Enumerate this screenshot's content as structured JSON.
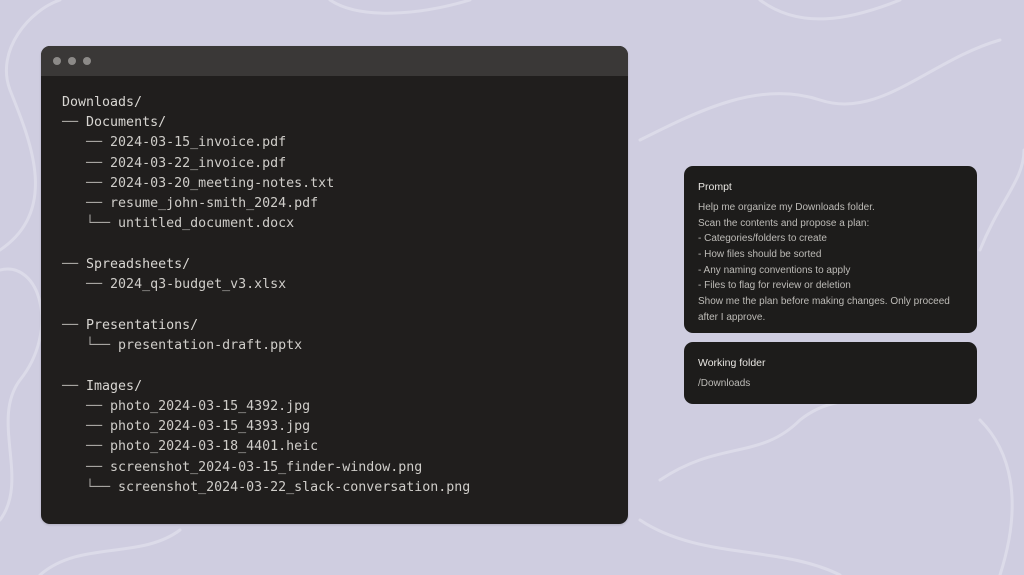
{
  "theme": {
    "background": "#cfcde0",
    "terminal_bg": "#201e1d",
    "titlebar_bg": "#3a3837",
    "card_bg": "#1d1c1b"
  },
  "terminal": {
    "window_controls": [
      "dot",
      "dot",
      "dot"
    ],
    "tree": [
      {
        "prefix": "",
        "name": "Downloads/",
        "kind": "folder"
      },
      {
        "prefix": "── ",
        "name": "Documents/",
        "kind": "folder"
      },
      {
        "prefix": "   ── ",
        "name": "2024-03-15_invoice.pdf",
        "kind": "file"
      },
      {
        "prefix": "   ── ",
        "name": "2024-03-22_invoice.pdf",
        "kind": "file"
      },
      {
        "prefix": "   ── ",
        "name": "2024-03-20_meeting-notes.txt",
        "kind": "file"
      },
      {
        "prefix": "   ── ",
        "name": "resume_john-smith_2024.pdf",
        "kind": "file"
      },
      {
        "prefix": "   └── ",
        "name": "untitled_document.docx",
        "kind": "file"
      },
      {
        "prefix": "",
        "name": "",
        "kind": "gap"
      },
      {
        "prefix": "── ",
        "name": "Spreadsheets/",
        "kind": "folder"
      },
      {
        "prefix": "   ── ",
        "name": "2024_q3-budget_v3.xlsx",
        "kind": "file"
      },
      {
        "prefix": "",
        "name": "",
        "kind": "gap"
      },
      {
        "prefix": "── ",
        "name": "Presentations/",
        "kind": "folder"
      },
      {
        "prefix": "   └── ",
        "name": "presentation-draft.pptx",
        "kind": "file"
      },
      {
        "prefix": "",
        "name": "",
        "kind": "gap"
      },
      {
        "prefix": "── ",
        "name": "Images/",
        "kind": "folder"
      },
      {
        "prefix": "   ── ",
        "name": "photo_2024-03-15_4392.jpg",
        "kind": "file"
      },
      {
        "prefix": "   ── ",
        "name": "photo_2024-03-15_4393.jpg",
        "kind": "file"
      },
      {
        "prefix": "   ── ",
        "name": "photo_2024-03-18_4401.heic",
        "kind": "file"
      },
      {
        "prefix": "   ── ",
        "name": "screenshot_2024-03-15_finder-window.png",
        "kind": "file"
      },
      {
        "prefix": "   └── ",
        "name": "screenshot_2024-03-22_slack-conversation.png",
        "kind": "file"
      }
    ]
  },
  "prompt_card": {
    "title": "Prompt",
    "lines": [
      "Help me organize my Downloads folder.",
      "Scan the contents and propose a plan:",
      "- Categories/folders to create",
      "- How files should be sorted",
      "- Any naming conventions to apply",
      "- Files to flag for review or deletion",
      "Show me the plan before making changes. Only proceed",
      "after I approve."
    ]
  },
  "working_folder_card": {
    "title": "Working folder",
    "path": "/Downloads"
  }
}
